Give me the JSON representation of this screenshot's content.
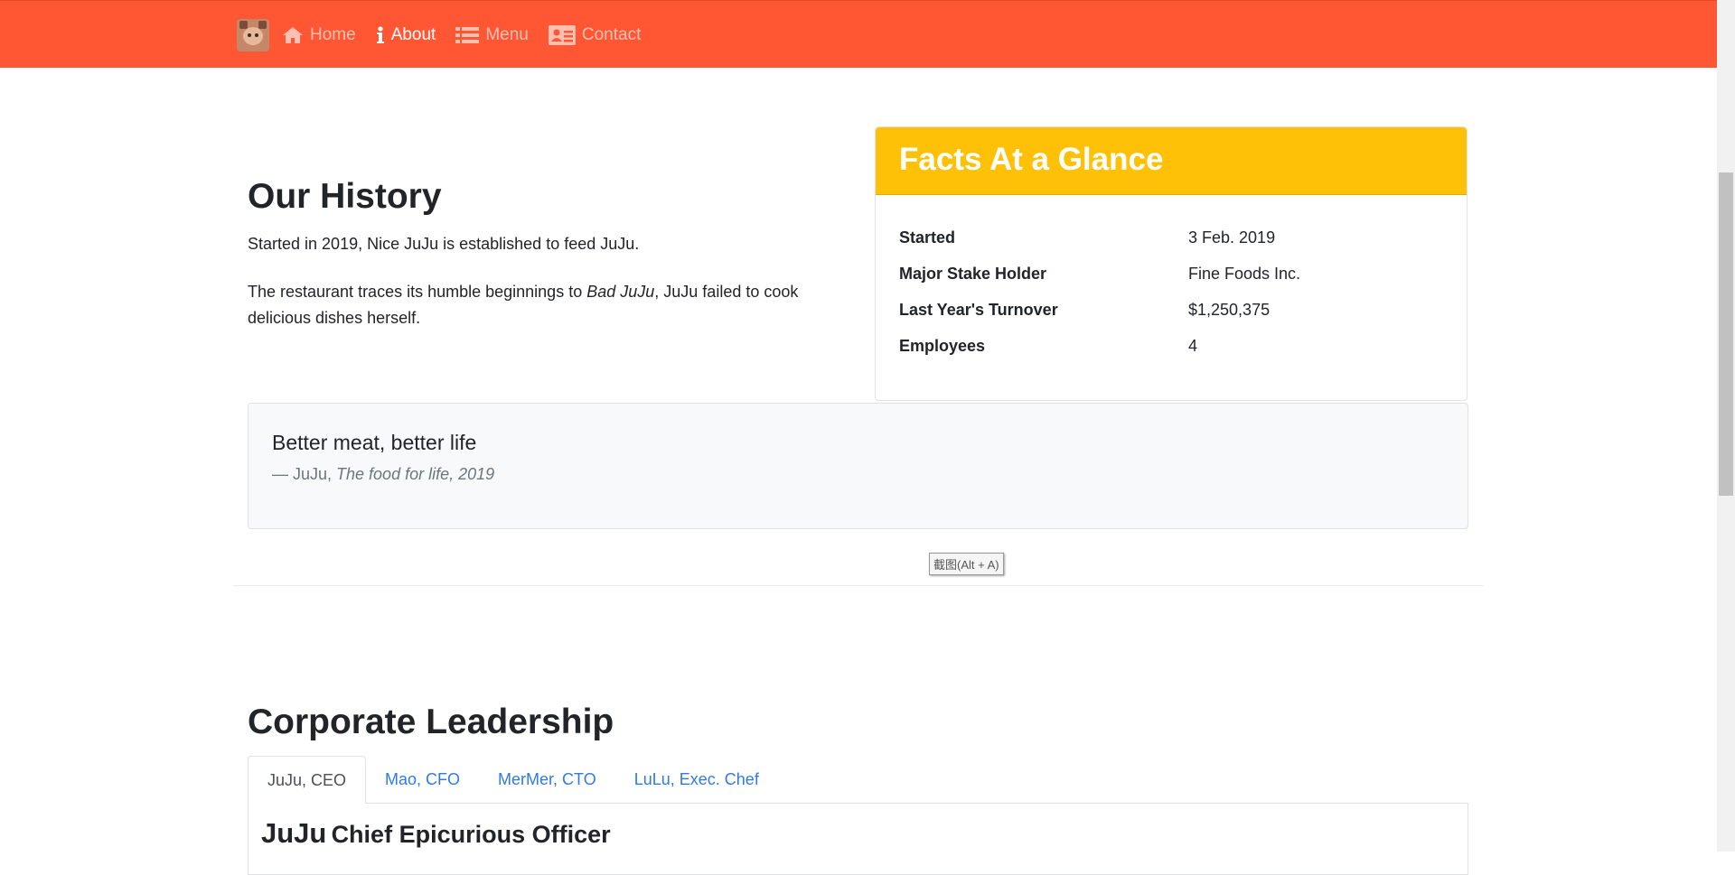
{
  "nav": {
    "items": [
      {
        "label": "Home",
        "icon": "home-icon"
      },
      {
        "label": "About",
        "icon": "info-icon"
      },
      {
        "label": "Menu",
        "icon": "list-icon"
      },
      {
        "label": "Contact",
        "icon": "contact-card-icon"
      }
    ],
    "active": "About",
    "bg_color": "#ff5733"
  },
  "history": {
    "title": "Our History",
    "p1": "Started in 2019, Nice JuJu is established to feed JuJu.",
    "p2_before": "The restaurant traces its humble beginnings to ",
    "p2_em": "Bad JuJu",
    "p2_after": ", JuJu failed to cook delicious dishes herself."
  },
  "facts": {
    "title": "Facts At a Glance",
    "header_color": "#ffc107",
    "rows": [
      {
        "label": "Started",
        "value": "3 Feb. 2019"
      },
      {
        "label": "Major Stake Holder",
        "value": "Fine Foods Inc."
      },
      {
        "label": "Last Year's Turnover",
        "value": "$1,250,375"
      },
      {
        "label": "Employees",
        "value": "4"
      }
    ]
  },
  "quote": {
    "text": "Better meat, better life",
    "footer_prefix": "— JuJu, ",
    "footer_cite": "The food for life, 2019"
  },
  "tooltip": {
    "text": "截图(Alt + A)"
  },
  "leadership": {
    "title": "Corporate Leadership",
    "tabs": [
      "JuJu, CEO",
      "Mao, CFO",
      "MerMer, CTO",
      "LuLu, Exec. Chef"
    ],
    "active_tab": "JuJu, CEO",
    "active_name": "JuJu",
    "active_role": "Chief Epicurious Officer",
    "link_color": "#2f7be6"
  }
}
